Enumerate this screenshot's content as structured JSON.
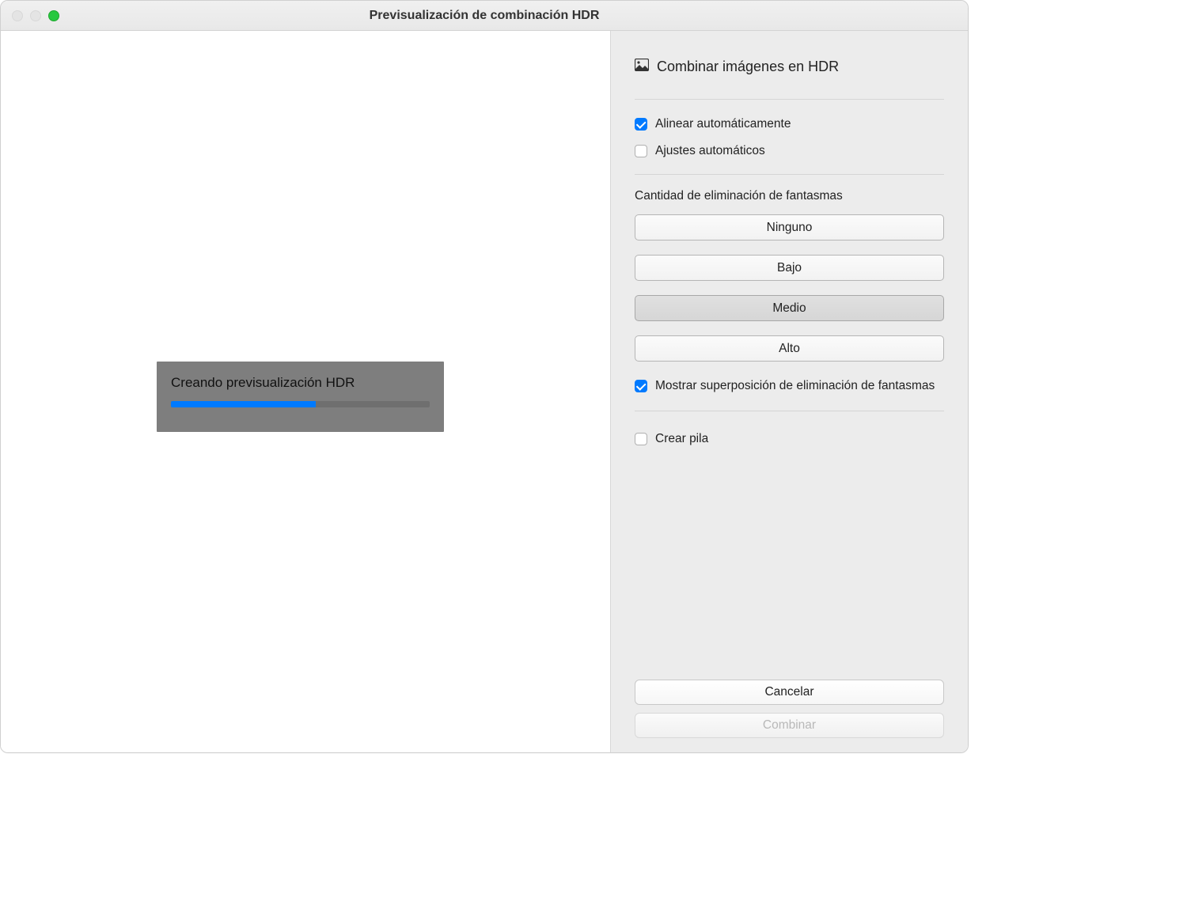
{
  "window": {
    "title": "Previsualización de combinación HDR"
  },
  "preview": {
    "progress_label": "Creando previsualización HDR",
    "progress_percent": 56
  },
  "sidebar": {
    "header": "Combinar imágenes en HDR",
    "auto_align": {
      "label": "Alinear automáticamente",
      "checked": true
    },
    "auto_adjust": {
      "label": "Ajustes automáticos",
      "checked": false
    },
    "ghost": {
      "label": "Cantidad de eliminación de fantasmas",
      "options": {
        "none": "Ninguno",
        "low": "Bajo",
        "medium": "Medio",
        "high": "Alto"
      },
      "selected": "medium",
      "overlay": {
        "label": "Mostrar superposición de eliminación de fantasmas",
        "checked": true
      }
    },
    "create_stack": {
      "label": "Crear pila",
      "checked": false
    }
  },
  "footer": {
    "cancel": "Cancelar",
    "merge": "Combinar"
  }
}
